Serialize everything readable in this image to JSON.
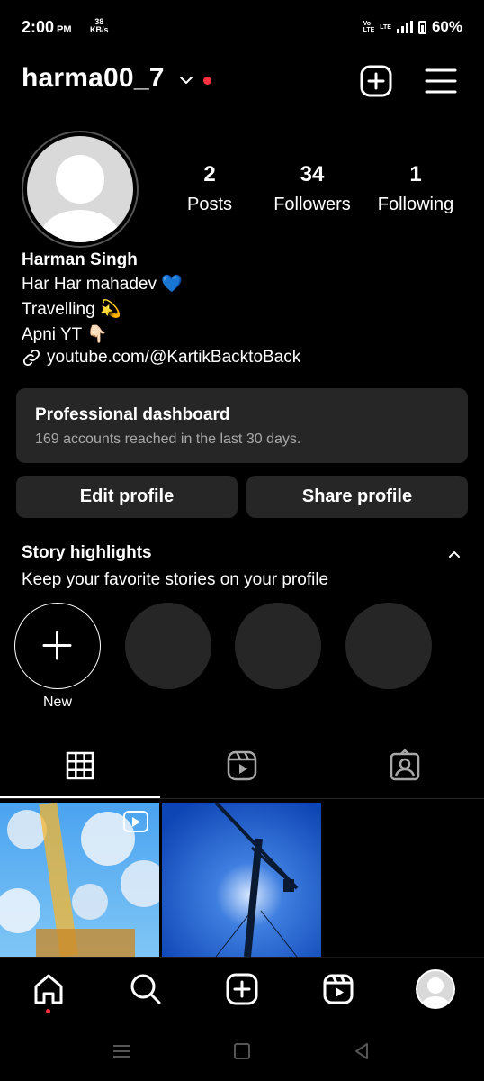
{
  "status_bar": {
    "time": "2:00",
    "ampm": "PM",
    "net_speed_value": "38",
    "net_speed_unit": "KB/s",
    "volte_top": "Vo",
    "volte_bottom": "LTE",
    "lte": "LTE",
    "battery": "60%"
  },
  "header": {
    "username": "harma00_7",
    "icons": [
      "chevron-down-icon",
      "new-post-icon",
      "menu-icon"
    ],
    "accent_color": "#ff3040"
  },
  "profile": {
    "stats": [
      {
        "value": "2",
        "label": "Posts"
      },
      {
        "value": "34",
        "label": "Followers"
      },
      {
        "value": "1",
        "label": "Following"
      }
    ],
    "name": "Harman Singh",
    "bio_lines": [
      "Har Har mahadev 💙",
      "Travelling 💫",
      "Apni YT 👇🏻"
    ],
    "link": "youtube.com/@KartikBacktoBack"
  },
  "dashboard": {
    "title": "Professional dashboard",
    "subtitle": "169 accounts reached in the last 30 days."
  },
  "buttons": {
    "edit": "Edit profile",
    "share": "Share profile"
  },
  "highlights": {
    "title": "Story highlights",
    "subtitle": "Keep your favorite stories on your profile",
    "new_label": "New"
  },
  "tabs": [
    "grid-icon",
    "reels-icon",
    "tagged-icon"
  ],
  "bottom_nav": [
    "home-icon",
    "search-icon",
    "create-icon",
    "reels-icon",
    "profile-avatar"
  ]
}
